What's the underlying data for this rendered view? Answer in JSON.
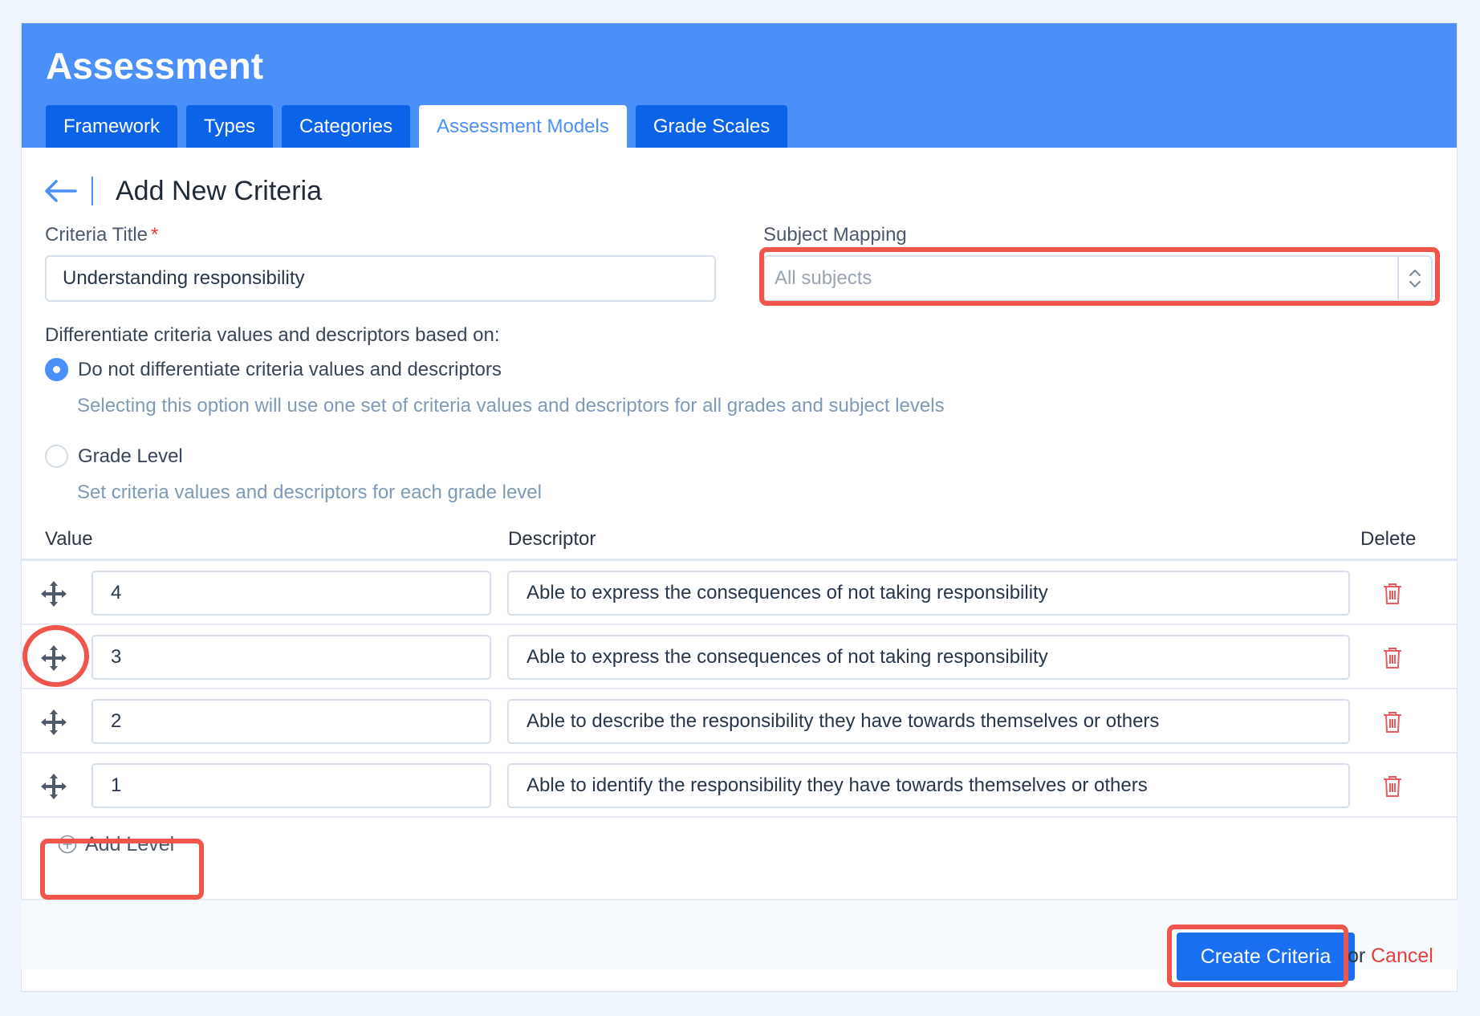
{
  "header": {
    "title": "Assessment",
    "tabs": [
      {
        "label": "Framework"
      },
      {
        "label": "Types"
      },
      {
        "label": "Categories"
      },
      {
        "label": "Assessment Models"
      },
      {
        "label": "Grade Scales"
      }
    ],
    "active_tab": "Assessment Models"
  },
  "page": {
    "title": "Add New Criteria",
    "back_icon": "arrow-left-icon"
  },
  "form": {
    "criteria_title_label": "Criteria Title",
    "required_mark": "*",
    "criteria_title_value": "Understanding responsibility",
    "subject_mapping_label": "Subject Mapping",
    "subject_mapping_placeholder": "All subjects",
    "differentiate_label": "Differentiate criteria values and descriptors based on:",
    "options": [
      {
        "label": "Do not differentiate criteria values and descriptors",
        "help": "Selecting this option will use one set of criteria values and descriptors for all grades and subject levels",
        "checked": true
      },
      {
        "label": "Grade Level",
        "help": "Set criteria values and descriptors for each grade level",
        "checked": false
      }
    ]
  },
  "table": {
    "headers": {
      "value": "Value",
      "descriptor": "Descriptor",
      "delete": "Delete"
    },
    "rows": [
      {
        "value": "4",
        "descriptor": "Able to express the consequences of not taking responsibility"
      },
      {
        "value": "3",
        "descriptor": "Able to express the consequences of not taking responsibility"
      },
      {
        "value": "2",
        "descriptor": "Able to describe the responsibility they have towards themselves or others"
      },
      {
        "value": "1",
        "descriptor": "Able to identify the responsibility they have towards themselves or others"
      }
    ]
  },
  "actions": {
    "add_level": "Add Level",
    "create": "Create Criteria",
    "or": "or",
    "cancel": "Cancel"
  },
  "colors": {
    "header_bg": "#4b8ff8",
    "tab_bg": "#0b63e8",
    "primary_button": "#1a6ef0",
    "highlight": "#f0554b",
    "danger": "#e53e3e"
  }
}
